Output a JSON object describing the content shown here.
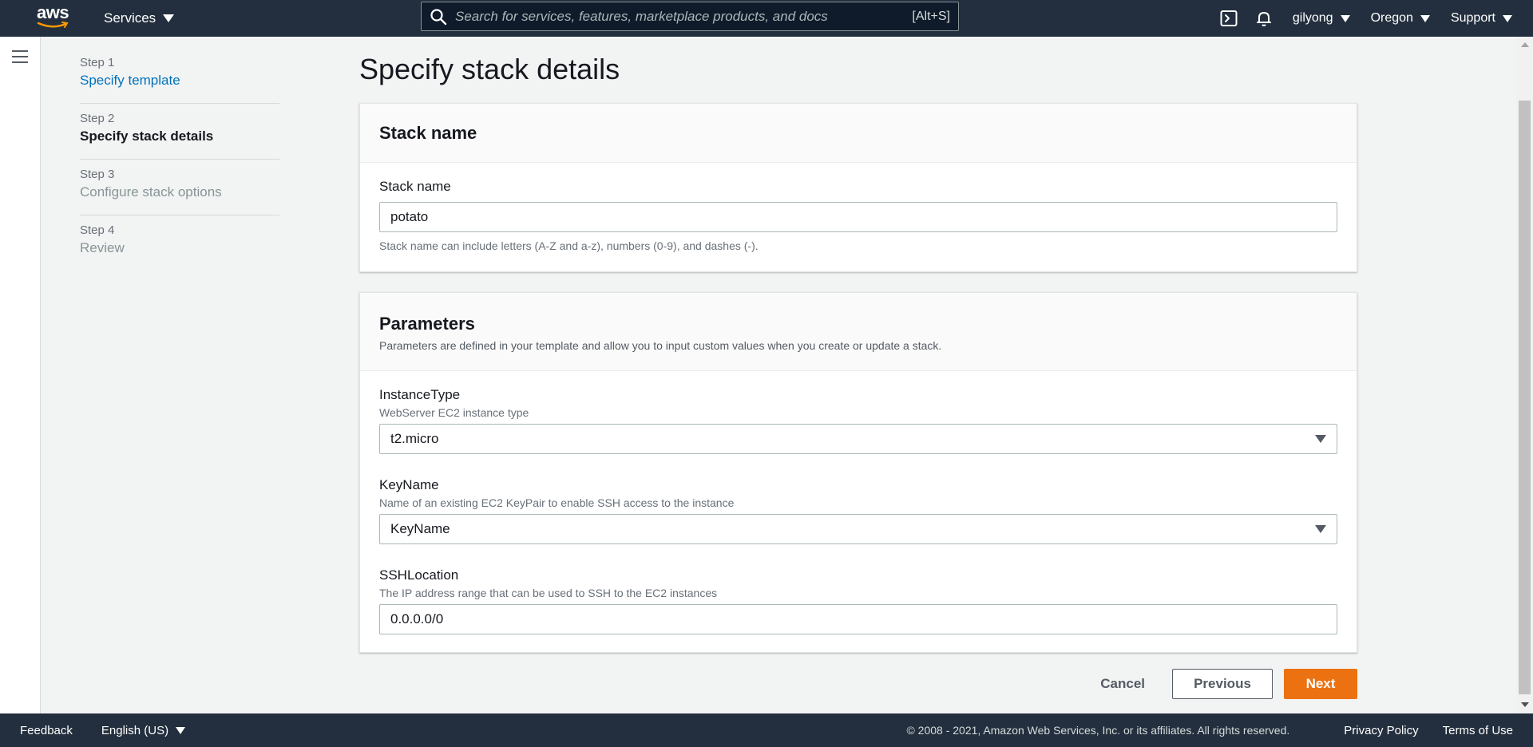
{
  "topnav": {
    "logo_text": "aws",
    "services_label": "Services",
    "search_placeholder": "Search for services, features, marketplace products, and docs",
    "search_shortcut": "[Alt+S]",
    "user": "gilyong",
    "region": "Oregon",
    "support": "Support",
    "icons": [
      "cloudshell-icon",
      "bell-icon"
    ]
  },
  "steps": [
    {
      "num": "Step 1",
      "name": "Specify template"
    },
    {
      "num": "Step 2",
      "name": "Specify stack details"
    },
    {
      "num": "Step 3",
      "name": "Configure stack options"
    },
    {
      "num": "Step 4",
      "name": "Review"
    }
  ],
  "page": {
    "title": "Specify stack details"
  },
  "stack_panel": {
    "header": "Stack name",
    "label": "Stack name",
    "value": "potato",
    "hint": "Stack name can include letters (A-Z and a-z), numbers (0-9), and dashes (-)."
  },
  "params_panel": {
    "header": "Parameters",
    "description": "Parameters are defined in your template and allow you to input custom values when you create or update a stack.",
    "instance_type": {
      "label": "InstanceType",
      "sublabel": "WebServer EC2 instance type",
      "value": "t2.micro"
    },
    "key_name": {
      "label": "KeyName",
      "sublabel": "Name of an existing EC2 KeyPair to enable SSH access to the instance",
      "value": "KeyName"
    },
    "ssh_location": {
      "label": "SSHLocation",
      "sublabel": "The IP address range that can be used to SSH to the EC2 instances",
      "value": "0.0.0.0/0"
    }
  },
  "buttons": {
    "cancel": "Cancel",
    "previous": "Previous",
    "next": "Next"
  },
  "footer": {
    "feedback": "Feedback",
    "language": "English (US)",
    "copyright": "© 2008 - 2021, Amazon Web Services, Inc. or its affiliates. All rights reserved.",
    "privacy": "Privacy Policy",
    "terms": "Terms of Use"
  },
  "colors": {
    "nav_bg": "#232f3e",
    "link": "#0073bb",
    "primary": "#ec7211"
  }
}
